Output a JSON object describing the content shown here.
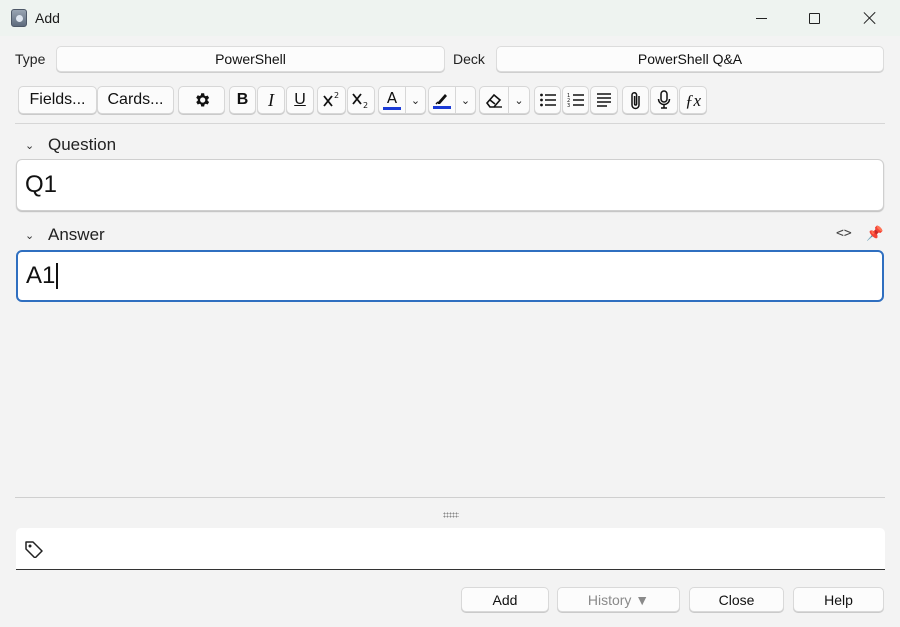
{
  "window": {
    "title": "Add"
  },
  "header": {
    "type_label": "Type",
    "type_value": "PowerShell",
    "deck_label": "Deck",
    "deck_value": "PowerShell Q&A"
  },
  "toolbar": {
    "fields_label": "Fields...",
    "cards_label": "Cards...",
    "bold_label": "B",
    "italic_label": "I",
    "underline_label": "U",
    "text_color": "#1a3ad6",
    "highlight_color": "#1a3ad6",
    "icons": [
      "gear-icon",
      "superscript-icon",
      "subscript-icon",
      "text-color-icon",
      "highlight-icon",
      "eraser-icon",
      "bullet-list-icon",
      "numbered-list-icon",
      "align-icon",
      "paperclip-icon",
      "microphone-icon",
      "function-icon"
    ]
  },
  "fields": [
    {
      "label": "Question",
      "value": "Q1"
    },
    {
      "label": "Answer",
      "value": "A1"
    }
  ],
  "tags": {
    "value": ""
  },
  "buttons": {
    "add": "Add",
    "history": "History ▼",
    "close": "Close",
    "help": "Help"
  },
  "colors": {
    "focus_border": "#2f6fc0"
  }
}
